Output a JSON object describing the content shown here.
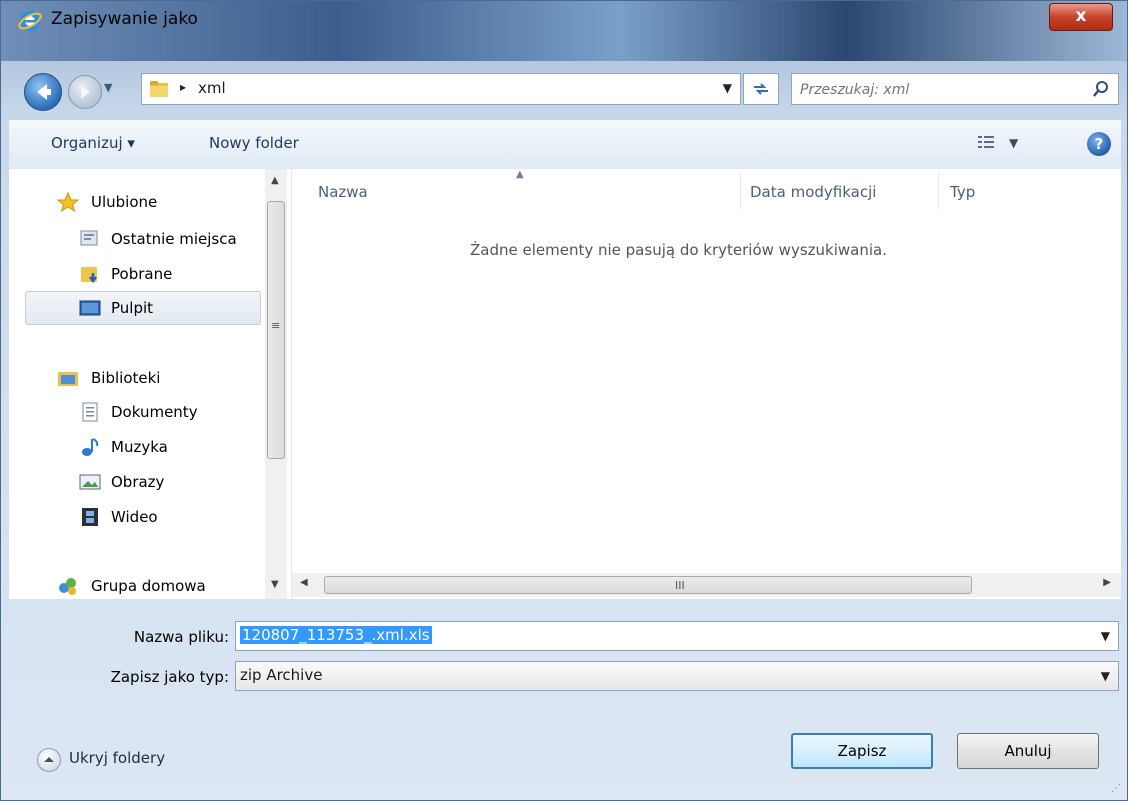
{
  "window": {
    "title": "Zapisywanie jako",
    "close_glyph": "x"
  },
  "addressbar": {
    "separator": "▸",
    "current_folder": "xml",
    "search_placeholder": "Przeszukaj: xml"
  },
  "commandbar": {
    "organize_label": "Organizuj ▾",
    "new_folder_label": "Nowy folder",
    "help_glyph": "?"
  },
  "navpane": {
    "favorites_label": "Ulubione",
    "favorites_items": [
      {
        "label": "Ostatnie miejsca"
      },
      {
        "label": "Pobrane"
      },
      {
        "label": "Pulpit"
      }
    ],
    "libraries_label": "Biblioteki",
    "library_items": [
      {
        "label": "Dokumenty"
      },
      {
        "label": "Muzyka"
      },
      {
        "label": "Obrazy"
      },
      {
        "label": "Wideo"
      }
    ],
    "homegroup_label": "Grupa domowa",
    "scroll_grip": "≡"
  },
  "filelist": {
    "columns": [
      "Nazwa",
      "Data modyfikacji",
      "Typ"
    ],
    "empty_message": "Żadne elementy nie pasują do kryteriów wyszukiwania.",
    "scroll_grip": "III"
  },
  "form": {
    "filename_label": "Nazwa pliku:",
    "filename_value": "120807_113753_.xml.xls",
    "filetype_label": "Zapisz jako typ:",
    "filetype_value": "zip Archive"
  },
  "footer": {
    "hide_folders_label": "Ukryj foldery",
    "save_label": "Zapisz",
    "cancel_label": "Anuluj"
  },
  "colors": {
    "selection": "#3399ff",
    "default_button_border": "#3c7fb1",
    "close_button": "#c9442c"
  }
}
